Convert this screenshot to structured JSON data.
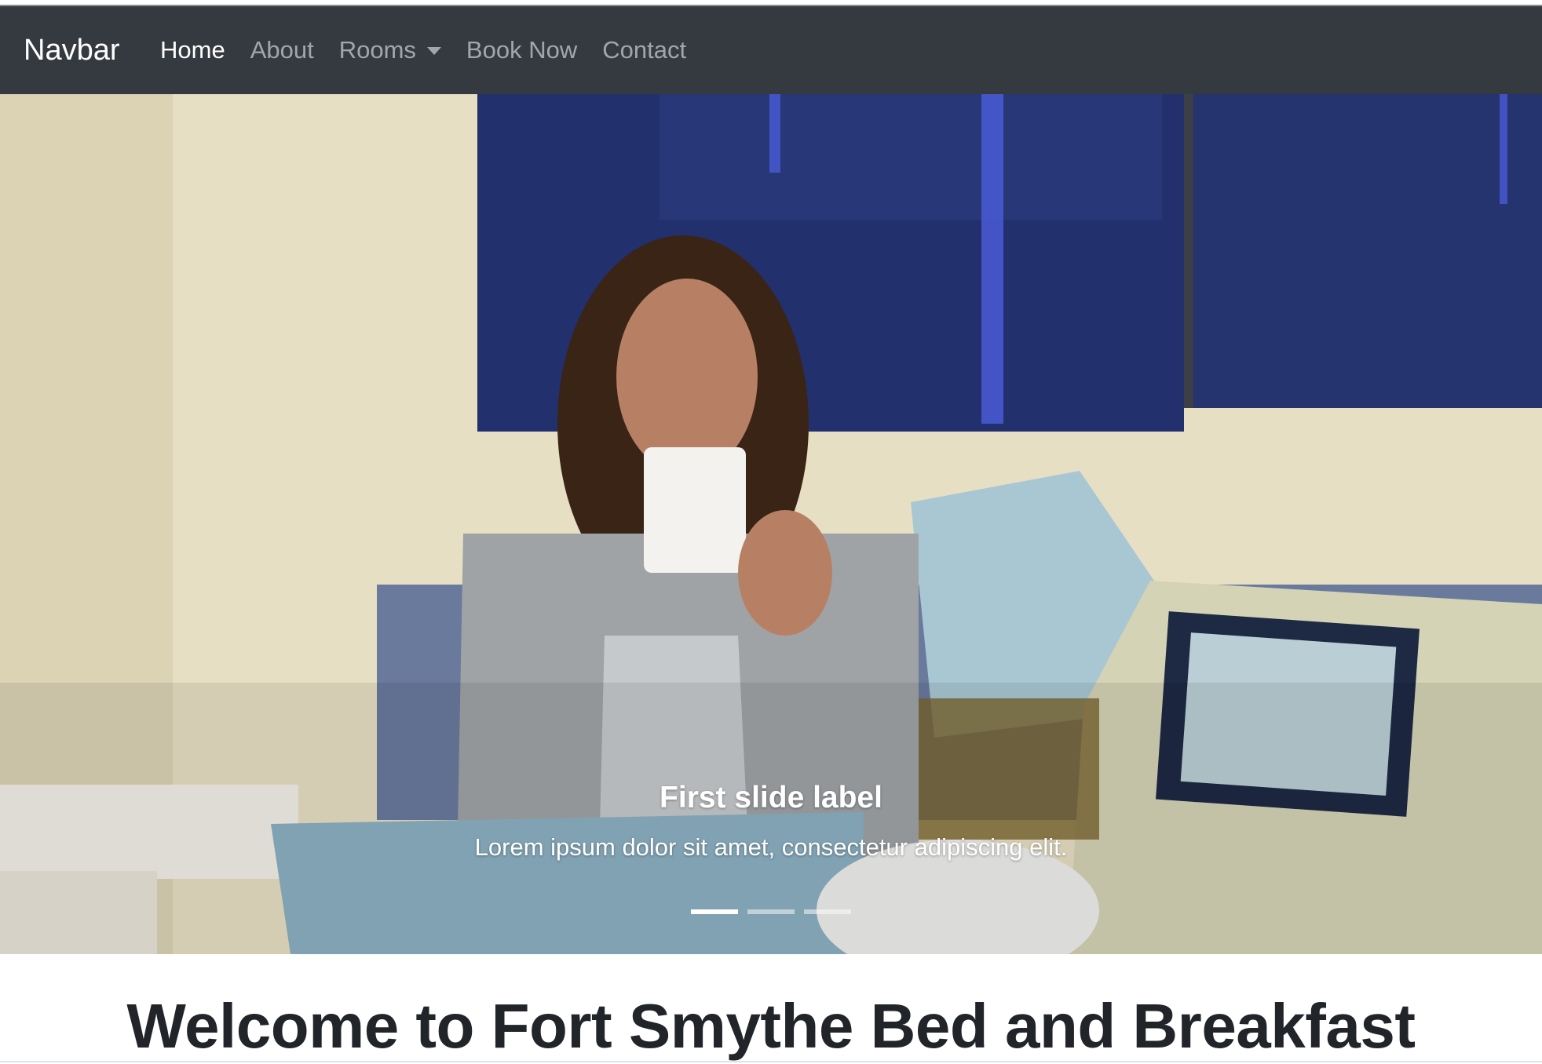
{
  "navbar": {
    "brand": "Navbar",
    "items": [
      {
        "label": "Home",
        "active": true
      },
      {
        "label": "About"
      },
      {
        "label": "Rooms",
        "dropdown": true
      },
      {
        "label": "Book Now"
      },
      {
        "label": "Contact"
      }
    ],
    "background": "#343a40"
  },
  "carousel": {
    "slide_title": "First slide label",
    "slide_text": "Lorem ipsum dolor sit amet, consectetur adipiscing elit.",
    "indicators_count": 3,
    "active_index": 0
  },
  "main": {
    "heading": "Welcome to Fort Smythe Bed and Breakfast"
  }
}
